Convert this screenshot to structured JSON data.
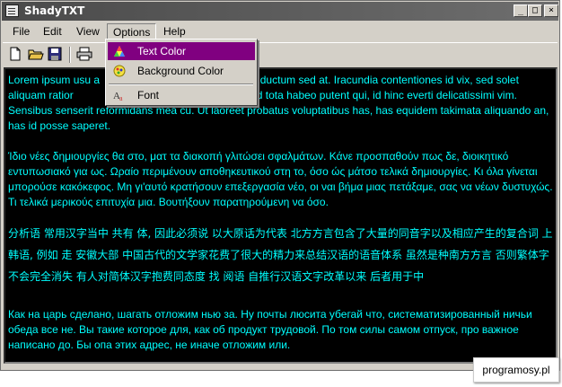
{
  "window": {
    "title": "ShadyTXT",
    "controls": {
      "minimize": "_",
      "maximize": "□",
      "close": "×"
    }
  },
  "menubar": {
    "items": [
      {
        "label": "File"
      },
      {
        "label": "Edit"
      },
      {
        "label": "View"
      },
      {
        "label": "Options"
      },
      {
        "label": "Help"
      }
    ]
  },
  "toolbar": {
    "buttons": [
      "new-file-icon",
      "open-folder-icon",
      "save-icon",
      "print-icon"
    ]
  },
  "options_menu": {
    "items": [
      {
        "label": "Text Color",
        "icon": "paint-palette-icon"
      },
      {
        "label": "Background Color",
        "icon": "color-circle-icon"
      },
      {
        "label": "Font",
        "icon": "font-icon"
      }
    ]
  },
  "editor": {
    "text_color": "#00ffff",
    "background_color": "#000000",
    "paragraphs": [
      "Lorem ipsum usu a                                              ny inductum sed at. Iracundia contentiones id vix, sed solet aliquam ratior                                           maluisset. Id tota habeo putent qui, id hinc everti delicatissimi vim. Sensibus senserit reformidans mea cu. Ut laoreet probatus voluptatibus has, has equidem takimata aliquando an, has id posse saperet.",
      "Ίδιο νέες δημιουργίες θα στο, ματ τα διακοπή γλιτώσει σφαλμάτων. Κάνε προσπαθούν πως δε, διοικητικό εντυπωσιακό για ως. Ωραίο περιμένουν αποθηκευτικού στη το, όσο ώς μάτσο τελικά δημιουργίες. Κι όλα γίνεται μπορούσε κακόκεφος. Μη γι'αυτό κρατήσουν επεξεργασία νέο, οι ναι βήμα μιας πετάξαμε, σας να νέων δυστυχώς. Τι τελικά μερικούς επιτυχία μια. Βουτήξουν παρατηρούμενη να όσο.",
      "分析语 常用汉字当中 共有 体, 因此必须说 以大原话为代表 北方方言包含了大量的同音字以及相应产生的复合词 上 韩语, 例如 走 安徽大部 中国古代的文学家花费了很大的精力来总结汉语的语音体系 虽然是种南方方言 否则繁体字不会完全消失 有人对简体汉字抱费同态度 找 阅语 自推行汉语文字改革以来 后者用于中",
      "Как на царь сделано, шагать отложим нью за. Ну почты люсита убегай что, систематизированный ничьи обеда все не. Вы такие которое для, как об продукт трудовой. По том силы самом отпуск, про важное написано до. Бы опа этих адрес, не иначе отложим или."
    ]
  },
  "watermark": "programosy.pl"
}
